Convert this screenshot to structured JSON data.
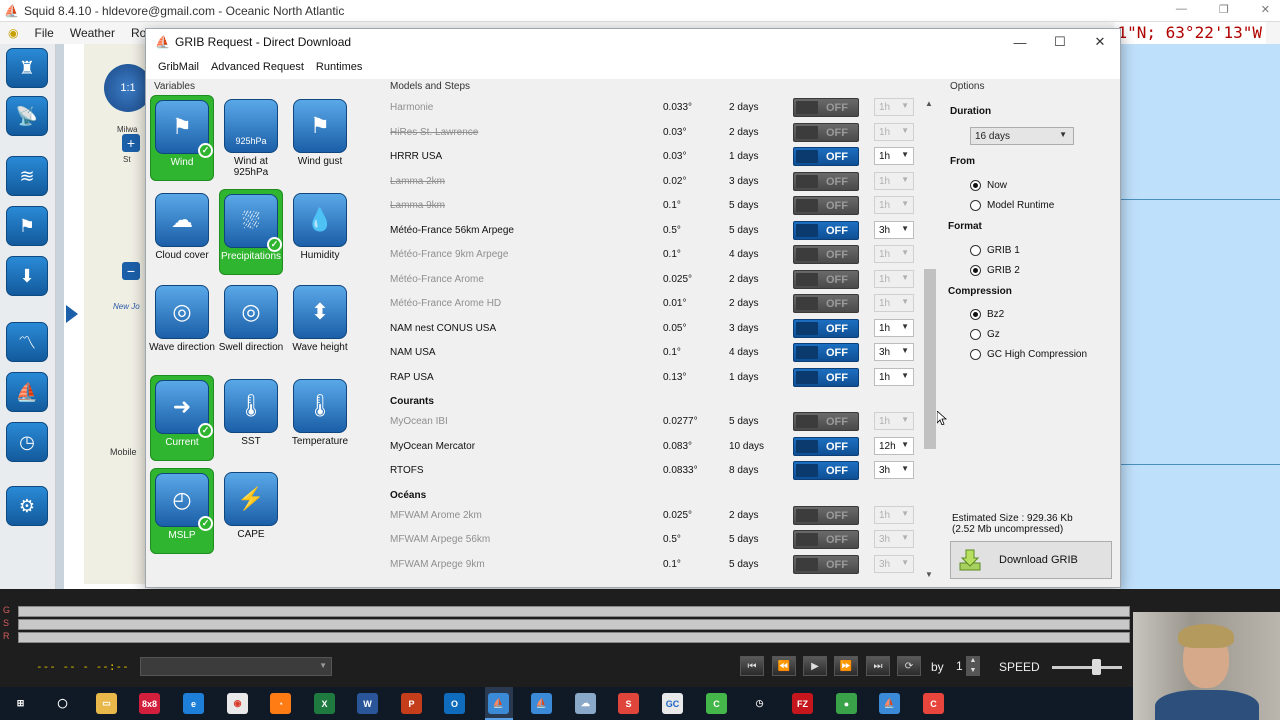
{
  "app": {
    "title": "Squid 8.4.10 - hldevore@gmail.com - Oceanic North Atlantic",
    "menu": [
      "File",
      "Weather",
      "Rout"
    ],
    "coord_readout": "1\"N; 63°22'13\"W",
    "map_labels": [
      "1:1",
      "New Jo",
      "Mobile",
      "Milwa",
      "St"
    ]
  },
  "dialog": {
    "title": "GRIB Request - Direct Download",
    "menu": [
      "GribMail",
      "Advanced Request",
      "Runtimes"
    ],
    "window_buttons": [
      "—",
      "☐",
      "✕"
    ]
  },
  "variables": {
    "title": "Variables",
    "tiles": [
      {
        "label": "Wind",
        "selected": true,
        "icon": "wind-flag-icon"
      },
      {
        "label": "Wind at 925hPa",
        "icon_text": "925hPa",
        "selected": false,
        "icon": "wind-flag-icon"
      },
      {
        "label": "Wind gust",
        "selected": false,
        "icon": "wind-gust-icon"
      },
      {
        "label": "Cloud cover",
        "selected": false,
        "icon": "cloud-icon"
      },
      {
        "label": "Precipitations",
        "selected": true,
        "icon": "rain-cloud-icon"
      },
      {
        "label": "Humidity",
        "selected": false,
        "icon": "water-drop-icon"
      },
      {
        "label": "Wave direction",
        "selected": false,
        "icon": "wave-compass-icon"
      },
      {
        "label": "Swell direction",
        "selected": false,
        "icon": "swell-compass-icon"
      },
      {
        "label": "Wave height",
        "selected": false,
        "icon": "wave-height-icon"
      },
      {
        "label": "Current",
        "selected": true,
        "icon": "current-arrow-icon"
      },
      {
        "label": "SST",
        "selected": false,
        "icon": "sea-thermometer-icon"
      },
      {
        "label": "Temperature",
        "selected": false,
        "icon": "thermometer-icon"
      },
      {
        "label": "MSLP",
        "selected": true,
        "icon": "barometer-icon"
      },
      {
        "label": "CAPE",
        "selected": false,
        "icon": "lightning-icon"
      }
    ]
  },
  "models": {
    "title": "Models and Steps",
    "rows": [
      {
        "name": "Harmonie",
        "res": "0.033°",
        "days": "2 days",
        "toggle": "OFF",
        "step": "1h",
        "disabled": true
      },
      {
        "name": "HiRes St. Lawrence",
        "res": "0.03°",
        "days": "2 days",
        "toggle": "OFF",
        "step": "1h",
        "disabled": true
      },
      {
        "name": "HRRR USA",
        "res": "0.03°",
        "days": "1 days",
        "toggle": "OFF",
        "step": "1h",
        "disabled": false
      },
      {
        "name": "Lamma 2km",
        "res": "0.02°",
        "days": "3 days",
        "toggle": "OFF",
        "step": "1h",
        "disabled": true
      },
      {
        "name": "Lamma 9km",
        "res": "0.1°",
        "days": "5 days",
        "toggle": "OFF",
        "step": "1h",
        "disabled": true
      },
      {
        "name": "Météo-France 56km Arpege",
        "res": "0.5°",
        "days": "5 days",
        "toggle": "OFF",
        "step": "3h",
        "disabled": false
      },
      {
        "name": "Météo-France 9km Arpege",
        "res": "0.1°",
        "days": "4 days",
        "toggle": "OFF",
        "step": "1h",
        "disabled": true
      },
      {
        "name": "Météo-France Arome",
        "res": "0.025°",
        "days": "2 days",
        "toggle": "OFF",
        "step": "1h",
        "disabled": true
      },
      {
        "name": "Météo-France Arome HD",
        "res": "0.01°",
        "days": "2 days",
        "toggle": "OFF",
        "step": "1h",
        "disabled": true
      },
      {
        "name": "NAM nest CONUS USA",
        "res": "0.05°",
        "days": "3 days",
        "toggle": "OFF",
        "step": "1h",
        "disabled": false
      },
      {
        "name": "NAM USA",
        "res": "0.1°",
        "days": "4 days",
        "toggle": "OFF",
        "step": "3h",
        "disabled": false
      },
      {
        "name": "RAP USA",
        "res": "0.13°",
        "days": "1 days",
        "toggle": "OFF",
        "step": "1h",
        "disabled": false
      }
    ],
    "section_currents": "Courants",
    "currents": [
      {
        "name": "MyOcean IBI",
        "res": "0.0277°",
        "days": "5 days",
        "toggle": "OFF",
        "step": "1h",
        "disabled": true
      },
      {
        "name": "MyOcean Mercator",
        "res": "0.083°",
        "days": "10 days",
        "toggle": "OFF",
        "step": "12h",
        "disabled": false
      },
      {
        "name": "RTOFS",
        "res": "0.0833°",
        "days": "8 days",
        "toggle": "OFF",
        "step": "3h",
        "disabled": false
      }
    ],
    "section_oceans": "Océans",
    "oceans": [
      {
        "name": "MFWAM Arome 2km",
        "res": "0.025°",
        "days": "2 days",
        "toggle": "OFF",
        "step": "1h",
        "disabled": true
      },
      {
        "name": "MFWAM Arpege 56km",
        "res": "0.5°",
        "days": "5 days",
        "toggle": "OFF",
        "step": "3h",
        "disabled": true
      },
      {
        "name": "MFWAM Arpege 9km",
        "res": "0.1°",
        "days": "5 days",
        "toggle": "OFF",
        "step": "3h",
        "disabled": true
      }
    ]
  },
  "options": {
    "title": "Options",
    "duration_label": "Duration",
    "duration_value": "16 days",
    "from_label": "From",
    "from_now": "Now",
    "from_runtime": "Model Runtime",
    "format_label": "Format",
    "grib1": "GRIB 1",
    "grib2": "GRIB 2",
    "compression_label": "Compression",
    "bz2": "Bz2",
    "gz": "Gz",
    "gc_high": "GC High Compression",
    "estimated_size": "Estimated Size : 929.36 Kb",
    "estimated_uncompressed": "(2.52 Mb uncompressed)",
    "download_label": "Download GRIB"
  },
  "timeline": {
    "rows": [
      "G",
      "S",
      "R"
    ],
    "date_text": "--- -- - --:--",
    "by_label": "by",
    "speed_value": "1",
    "speed_label": "SPEED"
  },
  "taskbar": {
    "icons": [
      "windows-start-icon",
      "cortana-icon",
      "file-explorer-icon",
      "8x8-icon",
      "edge-icon",
      "chrome-icon",
      "firefox-icon",
      "excel-icon",
      "word-icon",
      "powerpoint-icon",
      "outlook-icon",
      "squid-icon",
      "squid-icon-2",
      "weather-app-icon",
      "snagit-icon",
      "gc-icon",
      "camtasia-icon",
      "clock-app-icon",
      "filezilla-icon",
      "mixer-icon",
      "squid-icon-3",
      "camtasia-recorder-icon"
    ],
    "labels": {
      "8x8": "8x8",
      "gc": "GC",
      "s": "S",
      "c": "C",
      "fz": "FZ"
    }
  }
}
